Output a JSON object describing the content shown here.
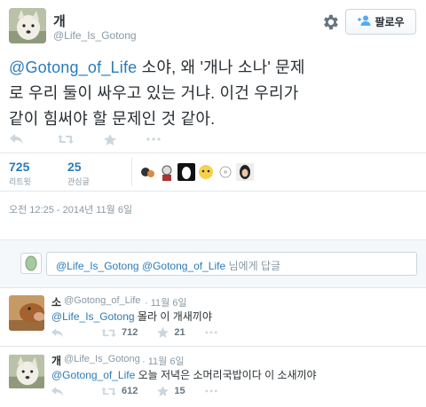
{
  "author": {
    "name": "개",
    "handle": "@Life_Is_Gotong"
  },
  "follow_button": {
    "label": "팔로우",
    "icon": "add-user-icon"
  },
  "tweet": {
    "mention": "@Gotong_of_Life",
    "text_line1": " 소야, 왜 '개나 소나' 문제",
    "text_line2": "로 우리 둘이 싸우고 있는 거냐. 이건 우리가",
    "text_line3": "같이 힘써야 할 문제인 것 같아."
  },
  "stats": {
    "retweets": {
      "count": "725",
      "label": "리트윗"
    },
    "favorites": {
      "count": "25",
      "label": "관심글"
    }
  },
  "timestamp": "오전 12:25 - 2014년 11월 6일",
  "reply_box": {
    "mention": "@Life_Is_Gotong @Gotong_of_Life",
    "suffix": " 님에게 답글"
  },
  "replies": [
    {
      "name": "소",
      "handle": "@Gotong_of_Life",
      "date": "· 11월 6일",
      "mention": "@Life_Is_Gotong",
      "text": " 몰라 이 개새끼야",
      "retweets": "712",
      "favorites": "21"
    },
    {
      "name": "개",
      "handle": "@Life_Is_Gotong",
      "date": "· 11월 6일",
      "mention": "@Gotong_of_Life",
      "text": " 오늘 저녁은 소머리국밥이다 이 소새끼야",
      "retweets": "612",
      "favorites": "15"
    }
  ],
  "colors": {
    "link": "#2b7bb9",
    "muted": "#8899a6",
    "text": "#292f33"
  }
}
